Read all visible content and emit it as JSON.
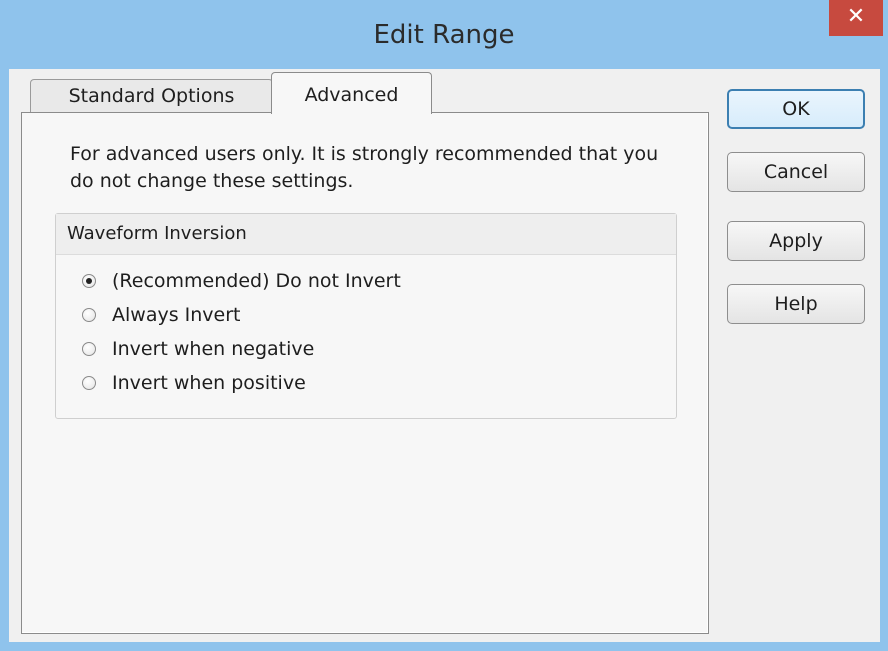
{
  "window": {
    "title": "Edit Range",
    "close_glyph": "✕"
  },
  "tabs": [
    {
      "label": "Standard Options",
      "active": false
    },
    {
      "label": "Advanced",
      "active": true
    }
  ],
  "advanced": {
    "description": "For advanced users only. It is strongly recommended that you do not change these settings.",
    "group_title": "Waveform Inversion",
    "options": [
      {
        "label": "(Recommended) Do not Invert",
        "selected": true
      },
      {
        "label": "Always Invert",
        "selected": false
      },
      {
        "label": "Invert when negative",
        "selected": false
      },
      {
        "label": "Invert when positive",
        "selected": false
      }
    ]
  },
  "buttons": {
    "ok": "OK",
    "cancel": "Cancel",
    "apply": "Apply",
    "help": "Help"
  },
  "colors": {
    "title_bar": "#8fc3ec",
    "close_button": "#c74a3f",
    "default_button_border": "#3c7fb1"
  }
}
